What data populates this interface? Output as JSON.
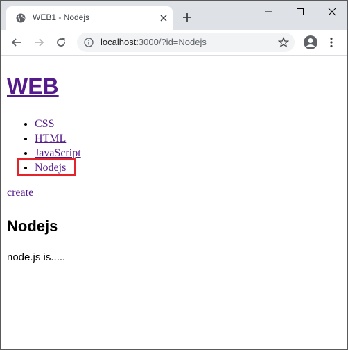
{
  "browser": {
    "tab": {
      "title": "WEB1 - Nodejs",
      "favicon": "globe-icon"
    },
    "address": {
      "host": "localhost",
      "path": ":3000/?id=Nodejs"
    },
    "window_controls": [
      "minimize-icon",
      "maximize-icon",
      "close-icon"
    ]
  },
  "page": {
    "heading": "WEB",
    "nav_items": [
      {
        "label": "CSS"
      },
      {
        "label": "HTML"
      },
      {
        "label": "JavaScript"
      },
      {
        "label": "Nodejs"
      }
    ],
    "create_link": "create",
    "title": "Nodejs",
    "description": "node.js is....."
  },
  "colors": {
    "link_visited": "#551a8b",
    "highlight_box": "#e3242b",
    "tabstrip": "#dee1e6"
  }
}
